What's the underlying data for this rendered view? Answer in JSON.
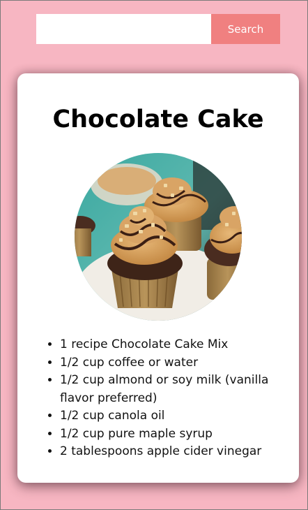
{
  "search": {
    "placeholder": "",
    "value": "",
    "button_label": "Search"
  },
  "recipe": {
    "title": "Chocolate Cake",
    "image_icon": "cupcake-photo",
    "ingredients": [
      "1 recipe Chocolate Cake Mix",
      "1/2 cup coffee or water",
      "1/2 cup almond or soy milk (vanilla flavor preferred)",
      "1/2 cup canola oil",
      "1/2 cup pure maple syrup",
      "2 tablespoons apple cider vinegar"
    ]
  },
  "colors": {
    "page_background": "#f7b6c2",
    "search_button": "#f08080",
    "card_background": "#ffffff"
  }
}
